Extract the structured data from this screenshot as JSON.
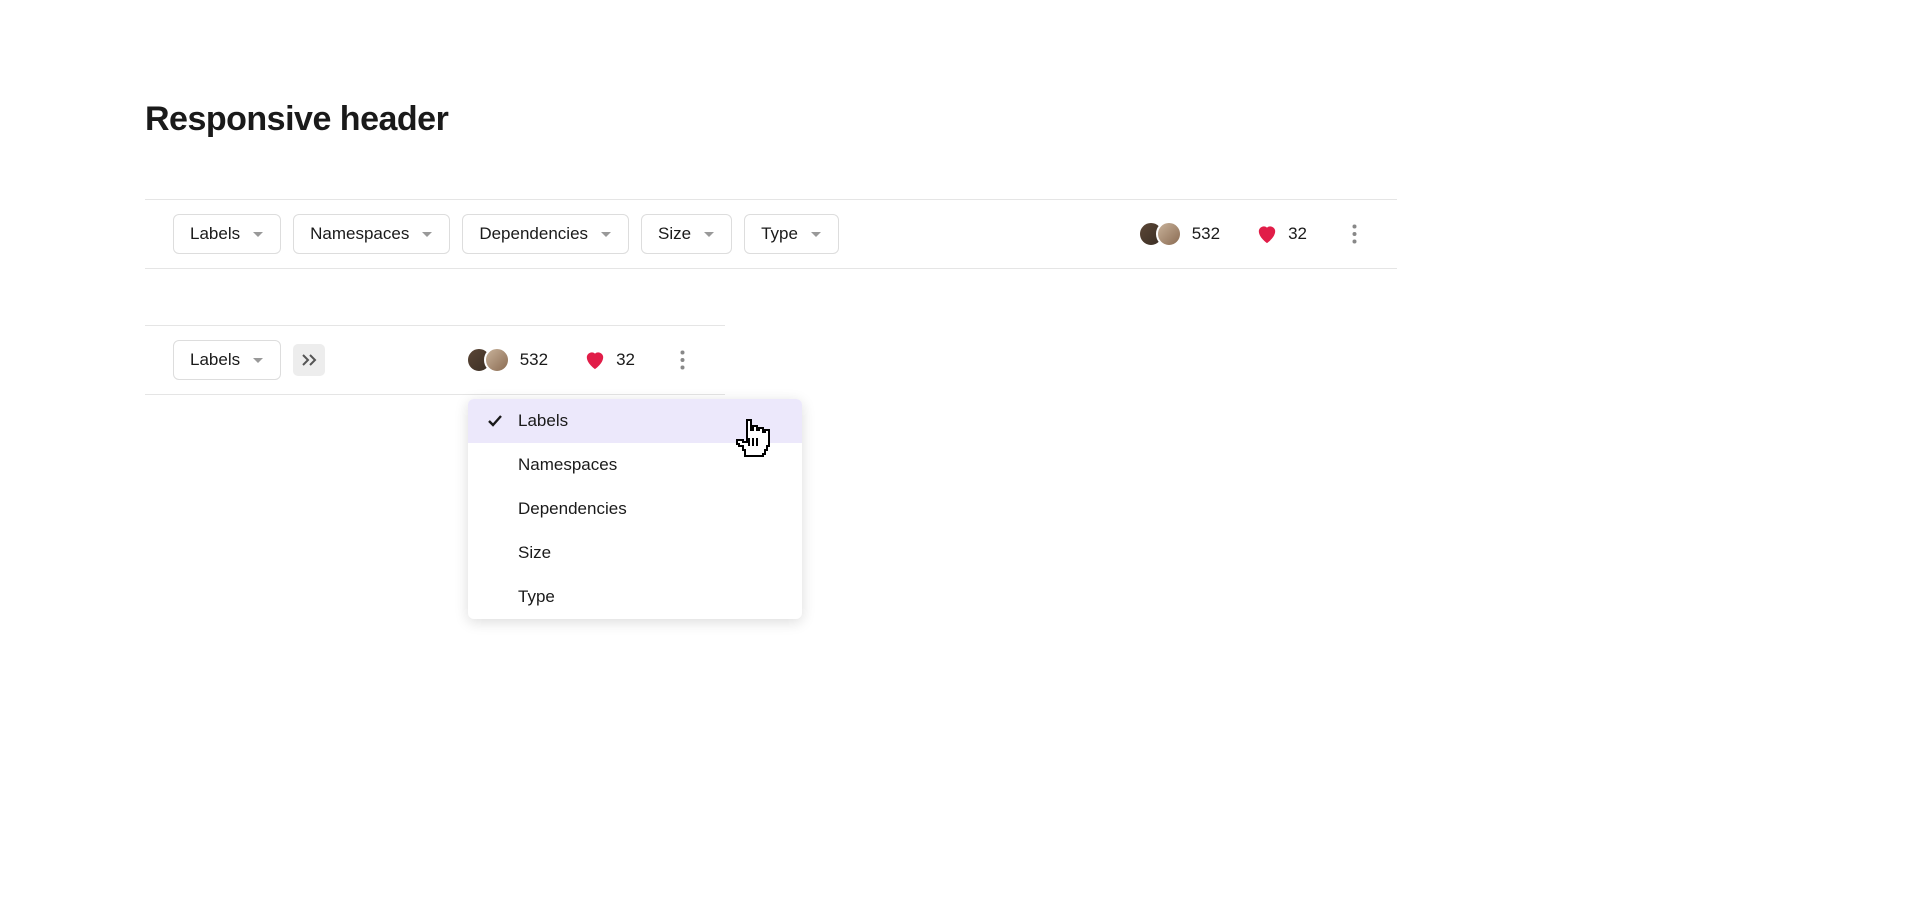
{
  "title": "Responsive header",
  "filters": [
    "Labels",
    "Namespaces",
    "Dependencies",
    "Size",
    "Type"
  ],
  "stats": {
    "members": "532",
    "likes": "32"
  },
  "narrow": {
    "visible_filter": "Labels"
  },
  "overflow_menu": {
    "items": [
      "Labels",
      "Namespaces",
      "Dependencies",
      "Size",
      "Type"
    ],
    "selected_index": 0
  },
  "colors": {
    "heart": "#e11d48",
    "highlight": "#ece8fb"
  }
}
